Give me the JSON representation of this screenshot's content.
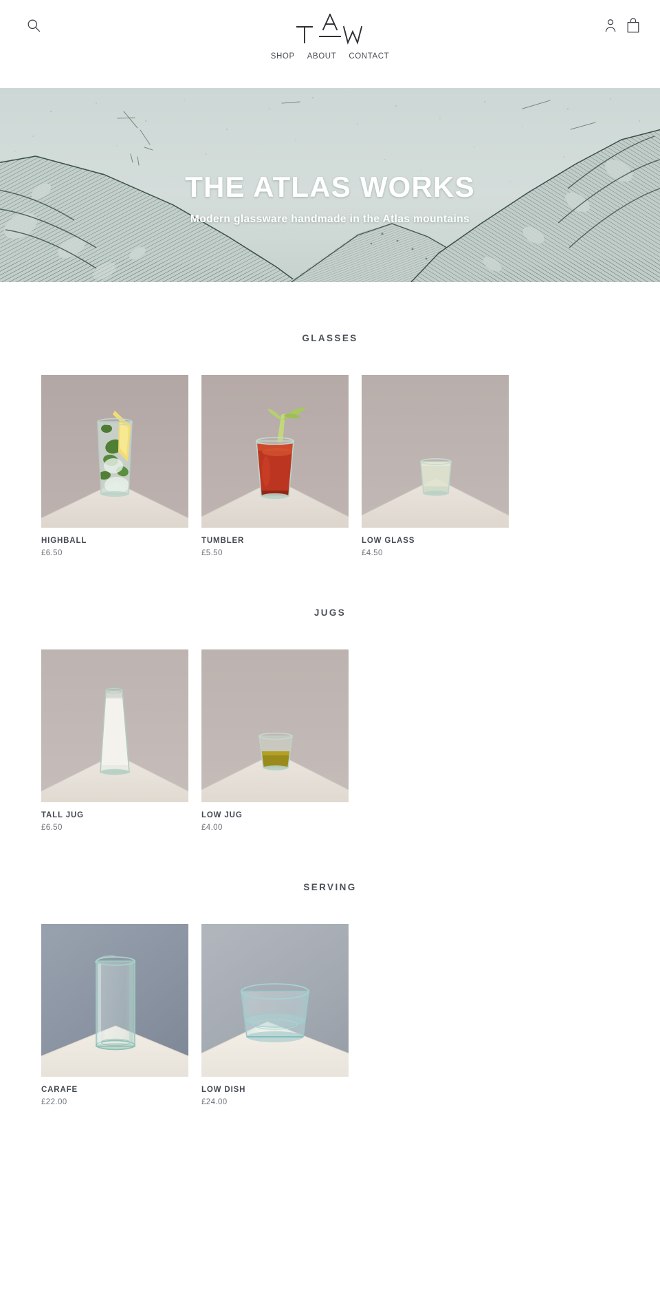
{
  "header": {
    "search_icon": "search-icon",
    "account_icon": "account-icon",
    "bag_icon": "shopping-bag-icon",
    "logo_text": "TAW",
    "logo_letters": {
      "left": "T",
      "top": "A",
      "right": "W"
    },
    "nav": [
      {
        "label": "SHOP"
      },
      {
        "label": "ABOUT"
      },
      {
        "label": "CONTACT"
      }
    ]
  },
  "hero": {
    "title": "THE ATLAS WORKS",
    "subtitle": "Modern glassware handmade in the Atlas mountains",
    "art": "mountain-engraving-illustration",
    "bg_color": "#cfd9d7",
    "ink_color": "#4c5f5c"
  },
  "collections": [
    {
      "title": "GLASSES",
      "products": [
        {
          "name": "HIGHBALL",
          "price": "£6.50",
          "image": "highball-glass-mojito-photo",
          "bg_color": "#b3a8a5",
          "table_color": "#e4ded6"
        },
        {
          "name": "TUMBLER",
          "price": "£5.50",
          "image": "tumbler-glass-bloody-mary-photo",
          "bg_color": "#b6aba8",
          "table_color": "#e3ddd5"
        },
        {
          "name": "LOW GLASS",
          "price": "£4.50",
          "image": "low-glass-white-wine-photo",
          "bg_color": "#b9afac",
          "table_color": "#e4ded6"
        }
      ]
    },
    {
      "title": "JUGS",
      "products": [
        {
          "name": "TALL JUG",
          "price": "£6.50",
          "image": "tall-jug-milk-photo",
          "bg_color": "#beb4b1",
          "table_color": "#e6e1d9"
        },
        {
          "name": "LOW JUG",
          "price": "£4.00",
          "image": "low-jug-olive-oil-photo",
          "bg_color": "#bdb3b0",
          "table_color": "#e5e0d8"
        }
      ]
    },
    {
      "title": "SERVING",
      "products": [
        {
          "name": "CARAFE",
          "price": "£22.00",
          "image": "carafe-clear-glass-photo",
          "bg_color": "#8b93a2",
          "table_color": "#eeeae2"
        },
        {
          "name": "LOW DISH",
          "price": "£24.00",
          "image": "low-dish-clear-glass-photo",
          "bg_color": "#a8adb5",
          "table_color": "#f0ece4"
        }
      ]
    }
  ]
}
